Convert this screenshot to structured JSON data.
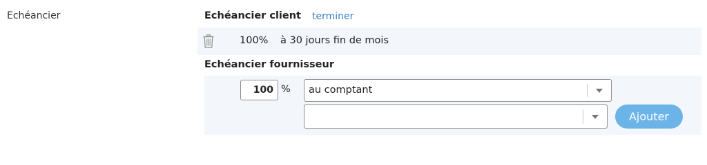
{
  "field": {
    "label": "Echéancier"
  },
  "client": {
    "title": "Echéancier client",
    "action_link": "terminer",
    "rows": [
      {
        "icon": "trash-icon",
        "percent": "100%",
        "terms": "à 30 jours fin de mois"
      }
    ]
  },
  "fournisseur": {
    "title": "Echéancier fournisseur",
    "percent_value": "100",
    "percent_sign": "%",
    "payment_select": {
      "selected": "au comptant",
      "icon": "chevron-down-icon"
    },
    "second_select": {
      "selected": "",
      "icon": "chevron-down-icon"
    },
    "add_button_label": "Ajouter"
  },
  "colors": {
    "link": "#3a7fc4",
    "button": "#6cb4e8",
    "panel_background": "#f3f6fa",
    "icon_gray": "#8c8c8c"
  }
}
